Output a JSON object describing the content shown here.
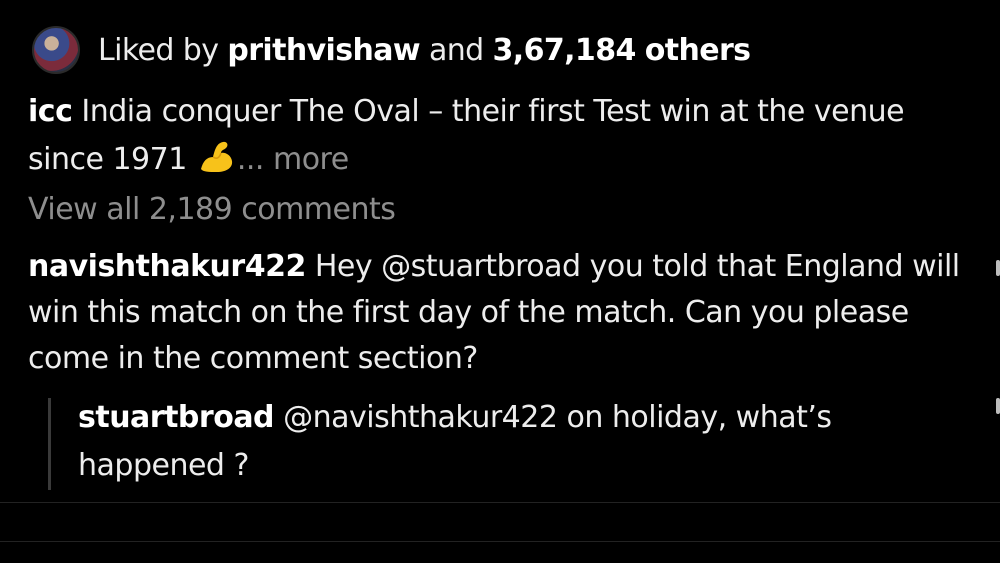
{
  "likes": {
    "prefix": "Liked by",
    "user": "prithvishaw",
    "conjunction": "and",
    "count": "3,67,184",
    "suffix": "others"
  },
  "caption": {
    "username": "icc",
    "text": "India conquer The Oval – their first Test win at the venue since 1971",
    "emoji": "flexed-biceps",
    "more": "... more"
  },
  "view_all_comments": "View all 2,189 comments",
  "comment": {
    "username": "navishthakur422",
    "text": "Hey @stuartbroad  you told that England will win this match on the first day of the match. Can you please come in the comment section?"
  },
  "reply": {
    "username": "stuartbroad",
    "text": "@navishthakur422 on holiday, what’s happened ?"
  }
}
